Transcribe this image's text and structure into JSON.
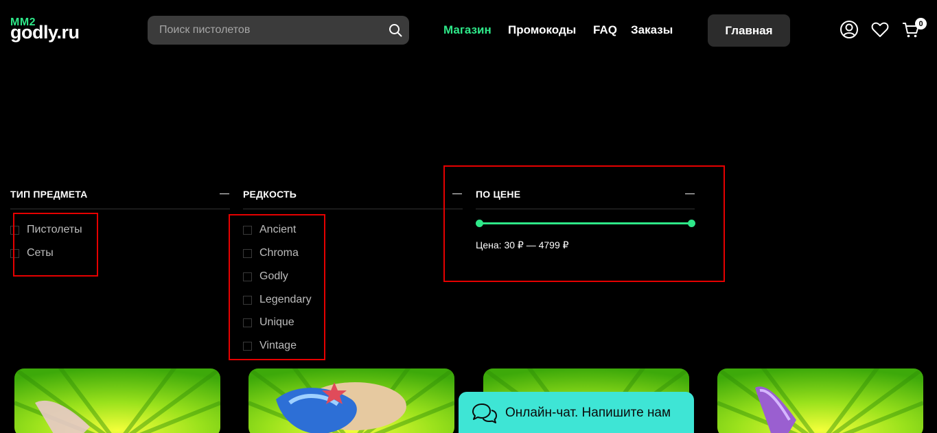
{
  "header": {
    "logo_top": "MM2",
    "logo_main": "godly.ru",
    "search_placeholder": "Поиск пистолетов",
    "nav": [
      {
        "label": "Магазин",
        "active": true
      },
      {
        "label": "Промокоды",
        "active": false
      },
      {
        "label": "FAQ",
        "active": false
      },
      {
        "label": "Заказы",
        "active": false
      }
    ],
    "home_button": "Главная",
    "cart_count": "0",
    "icons": [
      "user-icon",
      "heart-icon",
      "cart-icon",
      "search-icon"
    ]
  },
  "filters": {
    "type": {
      "title": "ТИП ПРЕДМЕТА",
      "toggle": "—",
      "options": [
        "Пистолеты",
        "Сеты"
      ]
    },
    "rarity": {
      "title": "РЕДКОСТЬ",
      "toggle": "—",
      "options": [
        "Ancient",
        "Chroma",
        "Godly",
        "Legendary",
        "Unique",
        "Vintage"
      ]
    },
    "price": {
      "title": "ПО ЦЕНЕ",
      "toggle": "—",
      "label": "Цена:",
      "min": "30 ₽",
      "separator": "—",
      "max": "4799 ₽"
    }
  },
  "chat": {
    "label": "Онлайн-чат. Напишите нам"
  },
  "colors": {
    "accent": "#2ee889",
    "highlight": "#e60000",
    "chat_bg": "#3ee5d5",
    "card_green": "#5fd11a"
  }
}
